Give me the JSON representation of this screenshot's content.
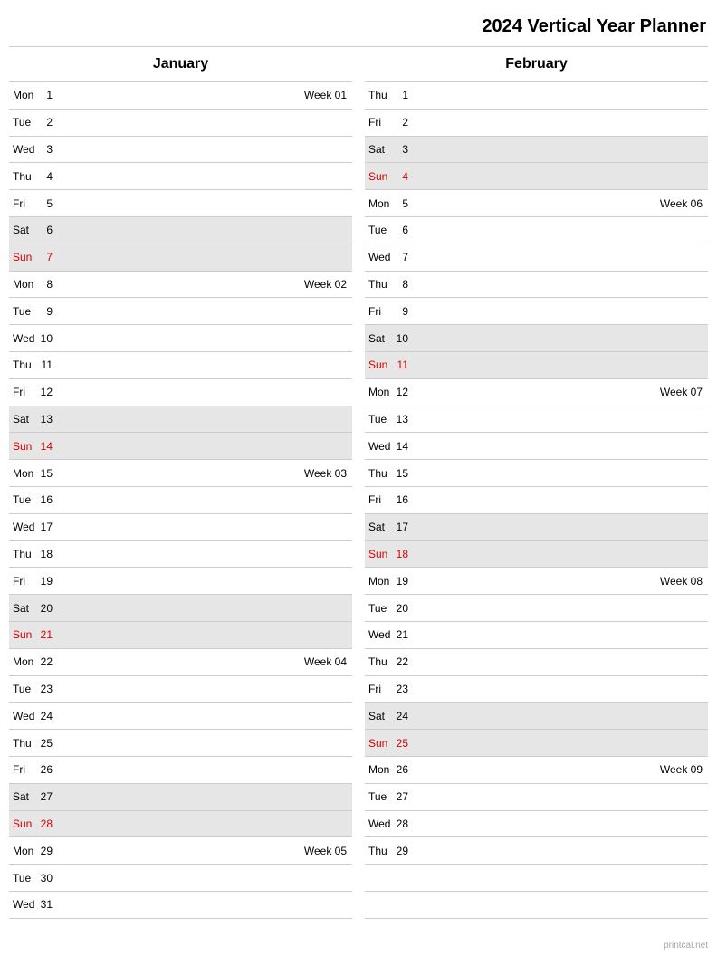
{
  "title": "2024 Vertical Year Planner",
  "footer": "printcal.net",
  "months": [
    {
      "name": "January",
      "days": 31,
      "first_weekday": 0,
      "week_map": {
        "1": "Week 01",
        "8": "Week 02",
        "15": "Week 03",
        "22": "Week 04",
        "29": "Week 05"
      }
    },
    {
      "name": "February",
      "days": 29,
      "first_weekday": 3,
      "week_map": {
        "5": "Week 06",
        "12": "Week 07",
        "19": "Week 08",
        "26": "Week 09"
      }
    }
  ],
  "dow_names": [
    "Mon",
    "Tue",
    "Wed",
    "Thu",
    "Fri",
    "Sat",
    "Sun"
  ],
  "rows_per_month": 31
}
